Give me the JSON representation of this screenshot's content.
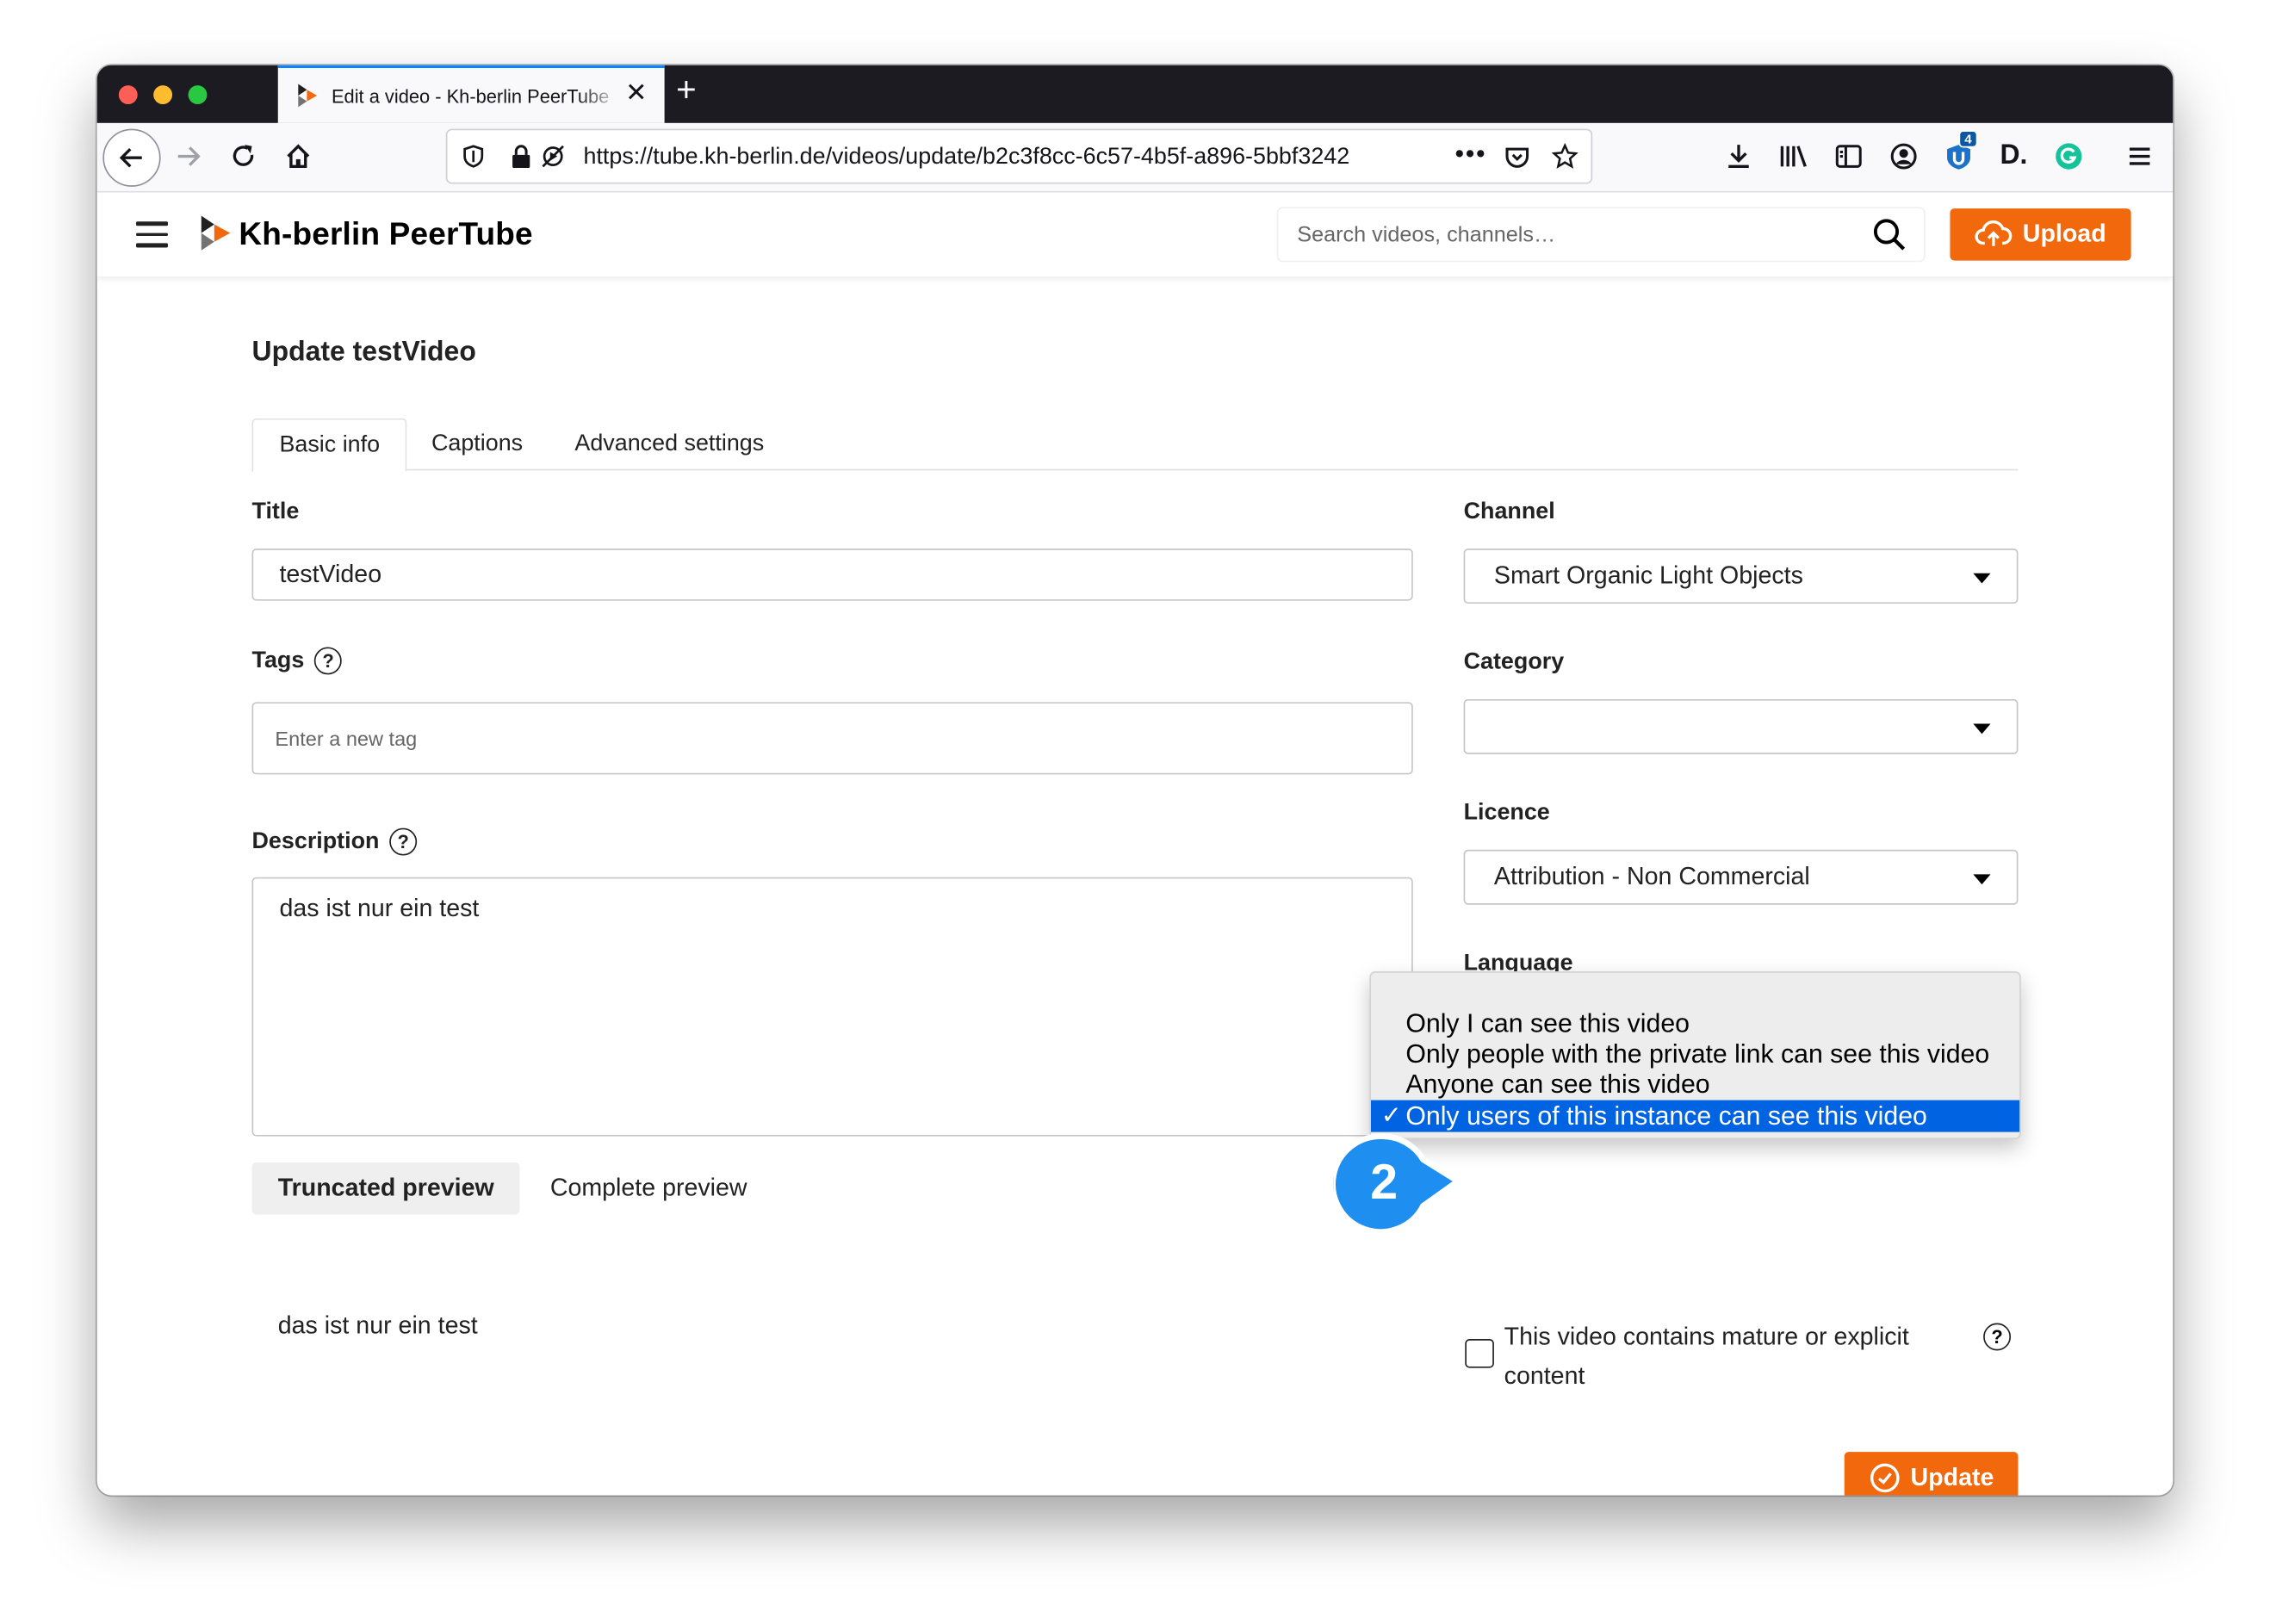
{
  "browser": {
    "tab_title": "Edit a video - Kh-berlin PeerTube",
    "url": "https://tube.kh-berlin.de/videos/update/b2c3f8cc-6c57-4b5f-a896-5bbf3242",
    "extension_badge": "4",
    "ext_d_label": "D."
  },
  "header": {
    "brand": "Kh-berlin PeerTube",
    "search_placeholder": "Search videos, channels…",
    "upload_label": "Upload"
  },
  "page": {
    "title": "Update testVideo",
    "tabs": [
      {
        "label": "Basic info",
        "active": true
      },
      {
        "label": "Captions",
        "active": false
      },
      {
        "label": "Advanced settings",
        "active": false
      }
    ]
  },
  "form": {
    "title_label": "Title",
    "title_value": "testVideo",
    "tags_label": "Tags",
    "tags_placeholder": "Enter a new tag",
    "description_label": "Description",
    "description_value": "das ist nur ein test",
    "preview_tabs": [
      "Truncated preview",
      "Complete preview"
    ],
    "preview_text": "das ist nur ein test",
    "help_glyph": "?",
    "channel_label": "Channel",
    "channel_value": "Smart Organic Light Objects",
    "category_label": "Category",
    "category_value": "",
    "licence_label": "Licence",
    "licence_value": "Attribution - Non Commercial",
    "language_label": "Language",
    "language_value": "",
    "mature_label": "This video contains mature or explicit content",
    "mature_checked": false,
    "update_label": "Update"
  },
  "privacy_dropdown": {
    "options": [
      "Only I can see this video",
      "Only people with the private link can see this video",
      "Anyone can see this video",
      "Only users of this instance can see this video"
    ],
    "selected_index": 3,
    "check_glyph": "✓"
  },
  "callout": {
    "number": "2",
    "color": "#1e8ef0"
  },
  "colors": {
    "accent": "#f1680d",
    "selection": "#0063e1"
  }
}
